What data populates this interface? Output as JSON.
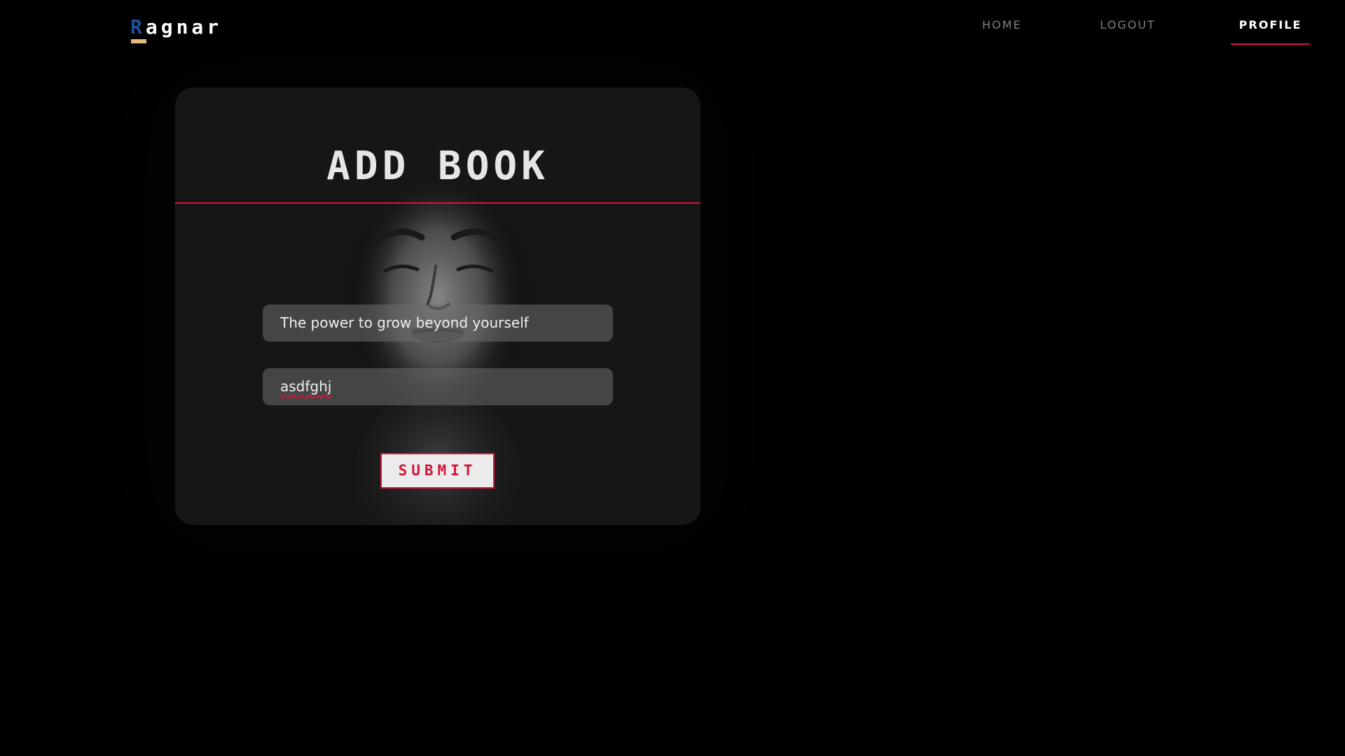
{
  "header": {
    "logo": {
      "first_letter": "R",
      "rest": "agnar"
    },
    "nav": {
      "home": "HOME",
      "logout": "LOGOUT",
      "profile": "PROFILE",
      "active": "profile"
    }
  },
  "form": {
    "title": "ADD BOOK",
    "fields": {
      "title_value": "The power to grow beyond yourself",
      "author_value": "asdfghj"
    },
    "submit_label": "SUBMIT"
  },
  "colors": {
    "background": "#000000",
    "accent": "#d3163c",
    "logo_blue": "#1e4f9c",
    "logo_underline": "#e6b97a",
    "card": "#161616"
  },
  "icons": {
    "background_photo": "portrait-photo"
  }
}
